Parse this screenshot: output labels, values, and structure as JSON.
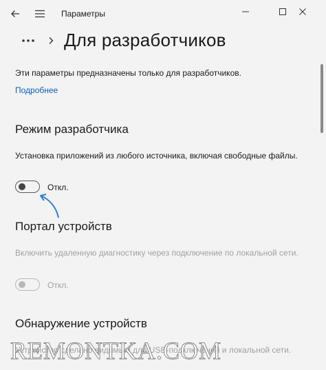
{
  "window": {
    "title": "Параметры"
  },
  "icons": {
    "back": "arrow-left-icon",
    "menu": "hamburger-menu-icon",
    "minimize": "minimize-icon",
    "maximize": "maximize-icon",
    "close": "close-icon",
    "more": "more-dots-icon",
    "separator": "chevron-right-icon"
  },
  "header": {
    "title": "Для разработчиков"
  },
  "intro": {
    "text": "Эти параметры предназначены только для разработчиков.",
    "link": "Подробнее"
  },
  "sections": [
    {
      "title": "Режим разработчика",
      "description": "Установка приложений из любого источника, включая свободные файлы.",
      "toggle_state": "Откл.",
      "enabled": true
    },
    {
      "title": "Портал устройств",
      "description": "Включить удаленную диагностику через подключение по локальной сети.",
      "toggle_state": "Откл.",
      "enabled": false
    },
    {
      "title": "Обнаружение устройств",
      "description": "Устройство сделано видимым для USB-подключений и локальной сети."
    }
  ],
  "watermark": "REMONTKA.COM",
  "colors": {
    "accent": "#0a5fb4",
    "annotation_arrow": "#2b7fd8",
    "background": "#f3f3f3"
  }
}
